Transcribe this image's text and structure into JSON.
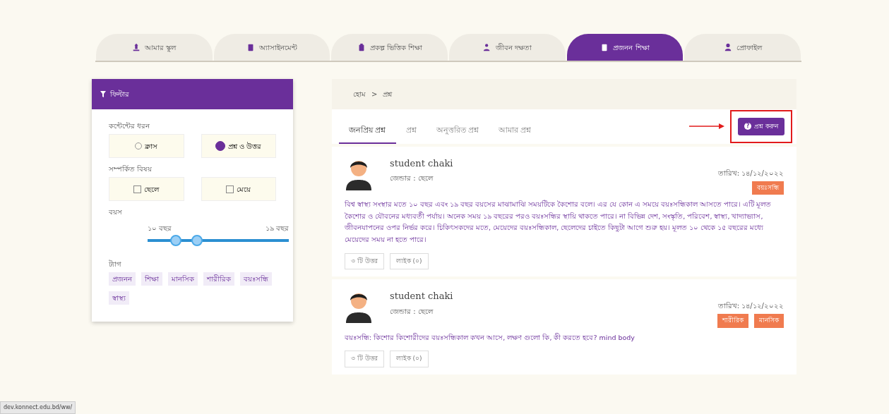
{
  "tabs": [
    {
      "label": "আমার স্কুল",
      "selected": false
    },
    {
      "label": "অ্যাসাইনমেন্ট",
      "selected": false
    },
    {
      "label": "প্রকল্প ভিত্তিক শিক্ষা",
      "selected": false
    },
    {
      "label": "জীবন দক্ষতা",
      "selected": false
    },
    {
      "label": "প্রজনন শিক্ষা",
      "selected": true
    },
    {
      "label": "প্রোফাইল",
      "selected": false
    }
  ],
  "filter": {
    "title": "ফিল্টার",
    "content_type": {
      "label": "কন্টেন্টের ধরন",
      "options": [
        {
          "label": "ক্লাস",
          "selected": false
        },
        {
          "label": "প্রশ্ন ও উত্তর",
          "selected": true
        }
      ]
    },
    "related": {
      "label": "সম্পর্কিত বিষয়",
      "options": [
        {
          "label": "ছেলে",
          "checked": false
        },
        {
          "label": "মেয়ে",
          "checked": false
        }
      ]
    },
    "age": {
      "label": "বয়স",
      "min_label": "১০ বছর",
      "max_label": "১৯ বছর",
      "thumbs": [
        {
          "level": 0.2
        },
        {
          "level": 0.35
        }
      ]
    },
    "tags": {
      "label": "ট্যাগ",
      "items": [
        "প্রজনন",
        "শিক্ষা",
        "মানসিক",
        "শারীরিক",
        "বয়ঃসন্ধি",
        "স্বাস্থ্য"
      ]
    }
  },
  "breadcrumb": {
    "items": [
      "হোম",
      "প্রশ্ন"
    ],
    "separator": ">"
  },
  "question_tabs": [
    {
      "label": "জনপ্রিয় প্রশ্ন",
      "selected": true
    },
    {
      "label": "প্রশ্ন",
      "selected": false
    },
    {
      "label": "অনুত্তরিত প্রশ্ন",
      "selected": false
    },
    {
      "label": "আমার প্রশ্ন",
      "selected": false
    }
  ],
  "ask_icon": "?",
  "ask_button": "প্রশ্ন করুন",
  "posts": [
    {
      "author": "student chaki",
      "gender": "জেন্ডার : ছেলে",
      "date": "তারিখ: ১৪/১২/২০২২",
      "tags": [
        "বয়ঃসন্ধি"
      ],
      "body": "বিশ্ব স্বাস্থ্য সংস্থার মতে ১০ বছর এবং ১৯ বছর বয়সের মাঝামাঝি সময়টিকে কৈশোর বলে। এর যে কোন এ সময়ে বয়ঃসন্ধিকাল আসতে পারে। এটি মূলত কৈশোর ও যৌবনের মধ্যবর্তী পর্যায়। অনেক সময় ১৯ বছরের পরও বয়ঃসন্ধির স্থায়ি থাকতে পারে। না বিভিন্ন দেশ, সংস্কৃতি, পরিবেশ, স্বাস্থ্য, খাদ্যাভ্যাস, জীবনযাপনের ওপর নির্ভর করে। চিকিৎসকদের মতে, মেয়েদের বয়ঃসন্ধিকাল, ছেলেদের চাইতে কিছুটা আগে শুরু হয়। মূলত ১০ থেকে ১৫ বছরের মধ্যে মেয়েদের সময় না হতে পারে।",
      "answers": "৩ টি উত্তর",
      "likes": "লাইক (০)"
    },
    {
      "author": "student chaki",
      "gender": "জেন্ডার : ছেলে",
      "date": "তারিখ: ১৪/১২/২০২২",
      "tags": [
        "শারীরিক",
        "মানসিক"
      ],
      "body": "বয়ঃসন্ধি: কিশোর কিশোরীদের বয়ঃসন্ধিকাল কখন আসে, লক্ষণ গুলো কি, কী করতে হবে? mind body",
      "answers": "৩ টি উত্তর",
      "likes": "লাইক (০)"
    }
  ],
  "status_url": "dev.konnect.edu.bd/ww/"
}
